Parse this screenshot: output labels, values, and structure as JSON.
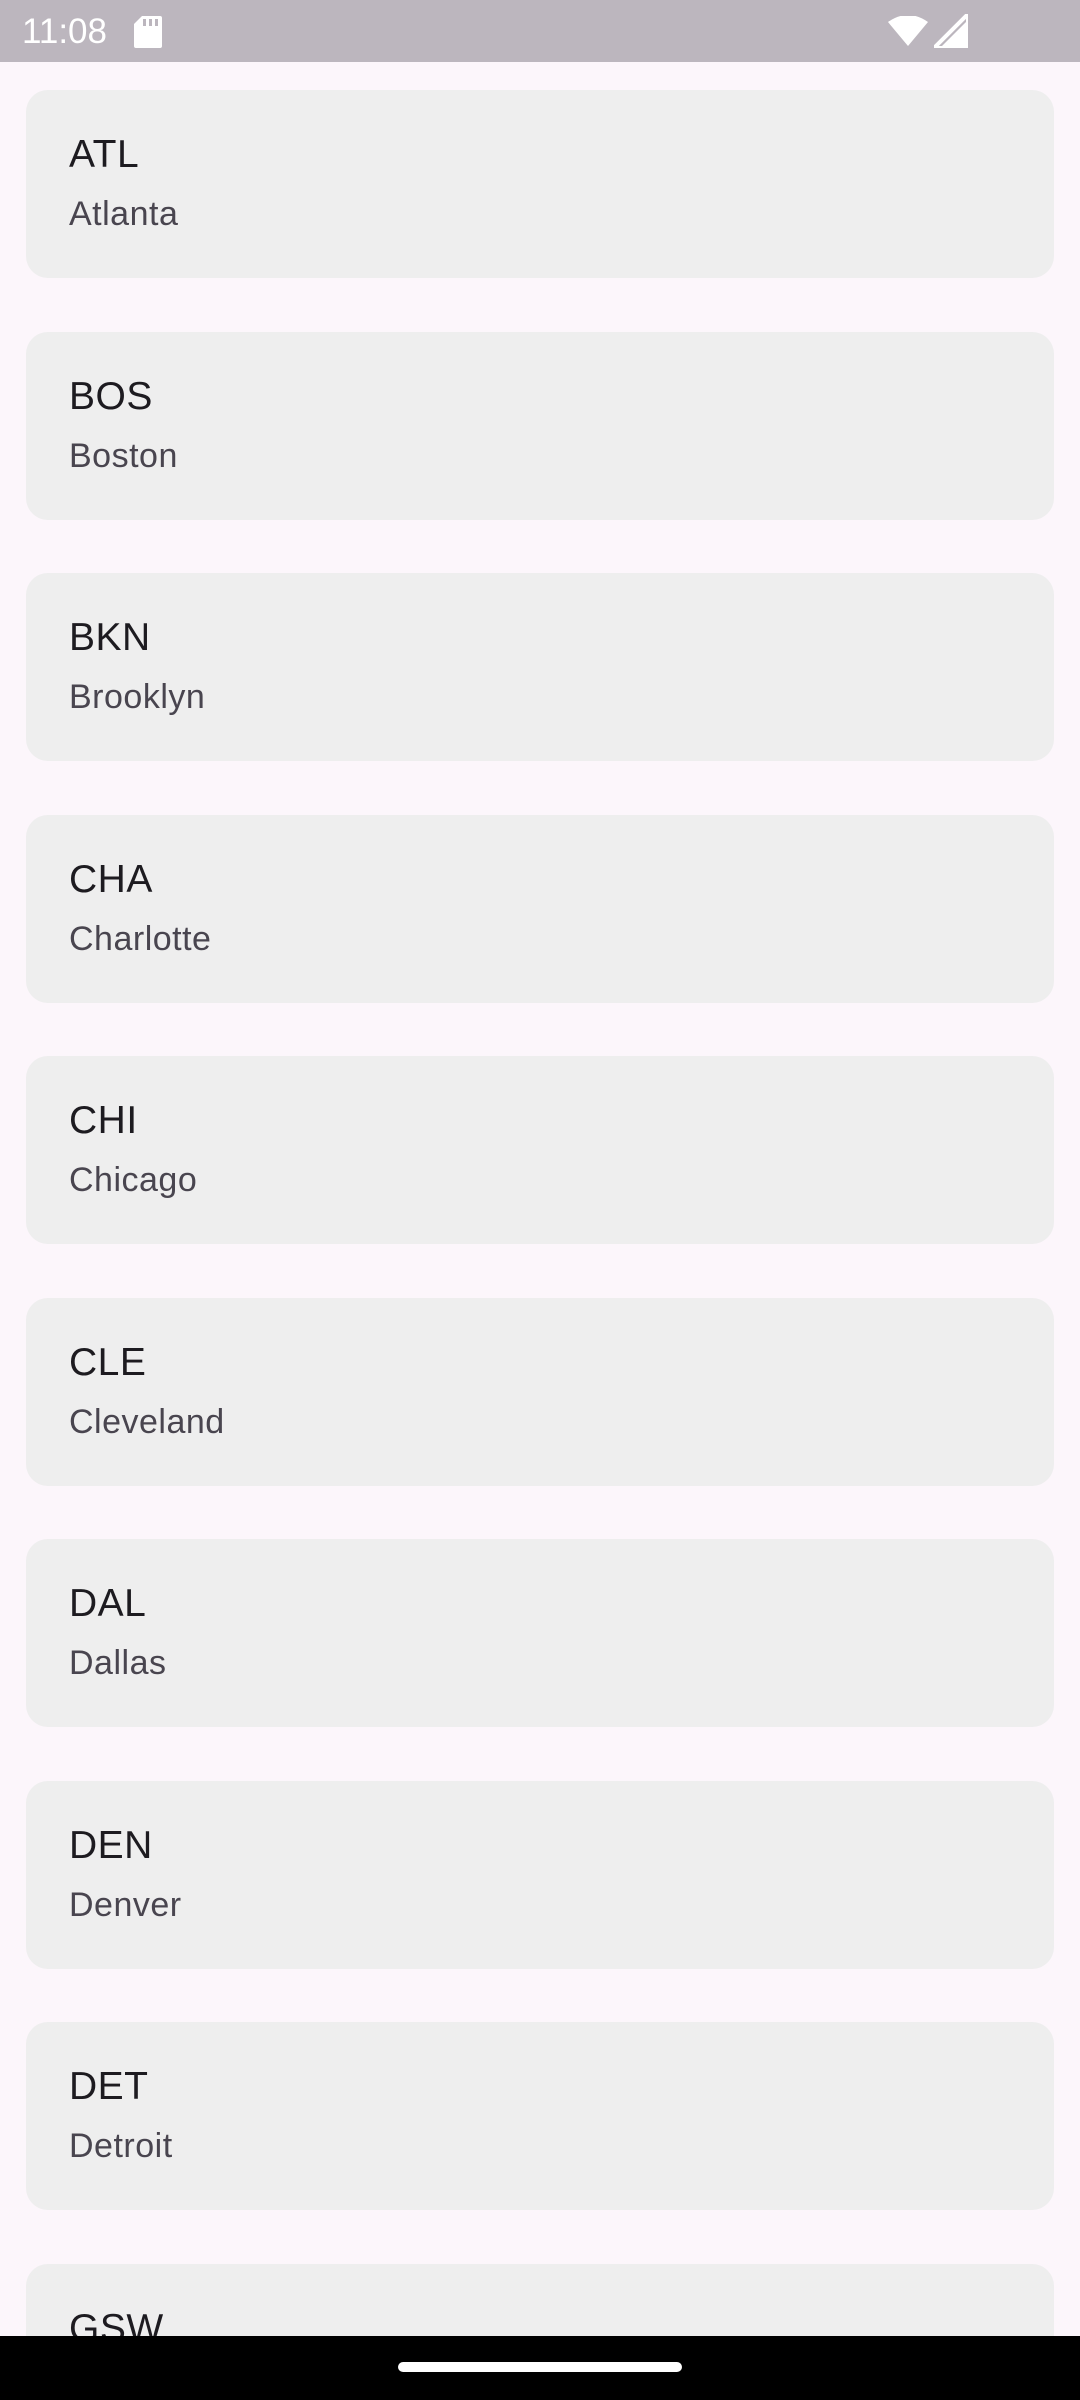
{
  "status_bar": {
    "time": "11:08",
    "icons": [
      "sd-card-icon",
      "wifi-icon",
      "cellular-signal-icon"
    ]
  },
  "teams": [
    {
      "code": "ATL",
      "city": "Atlanta"
    },
    {
      "code": "BOS",
      "city": "Boston"
    },
    {
      "code": "BKN",
      "city": "Brooklyn"
    },
    {
      "code": "CHA",
      "city": "Charlotte"
    },
    {
      "code": "CHI",
      "city": "Chicago"
    },
    {
      "code": "CLE",
      "city": "Cleveland"
    },
    {
      "code": "DAL",
      "city": "Dallas"
    },
    {
      "code": "DEN",
      "city": "Denver"
    },
    {
      "code": "DET",
      "city": "Detroit"
    },
    {
      "code": "GSW",
      "city": ""
    }
  ],
  "colors": {
    "background": "#FCF6FB",
    "status_bar": "#BCB6BE",
    "card": "#EEEEEE",
    "primary_text": "#1D1B20",
    "secondary_text": "#49454F"
  }
}
